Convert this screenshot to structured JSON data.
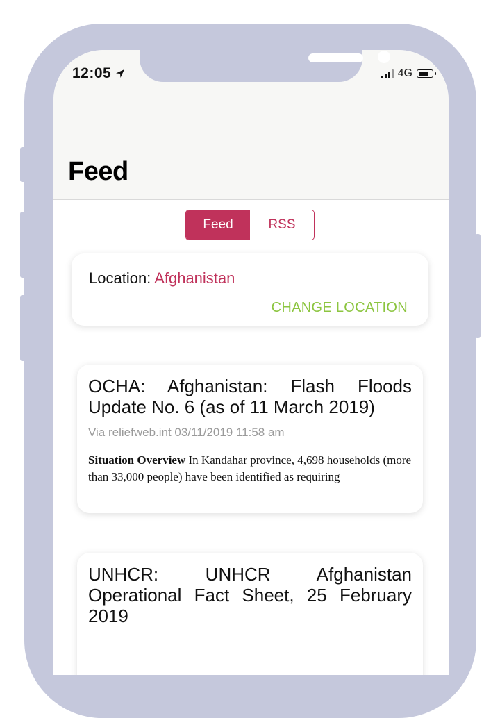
{
  "status_bar": {
    "time": "12:05",
    "network": "4G"
  },
  "header": {
    "title": "Feed"
  },
  "segmented_control": {
    "options": [
      "Feed",
      "RSS"
    ],
    "selected": "Feed"
  },
  "location_card": {
    "label": "Location: ",
    "value": "Afghanistan",
    "change_label": "CHANGE LOCATION"
  },
  "feed_items": [
    {
      "title": "OCHA: Afghanistan: Flash Floods Update No. 6 (as of 11 March 2019)",
      "meta": "Via reliefweb.int 03/11/2019 11:58 am",
      "excerpt_heading": "Situation Overview",
      "excerpt_text": " In Kandahar province, 4,698 households (more than 33,000 people) have been identified as requiring"
    },
    {
      "title": "UNHCR: UNHCR Afghanistan Operational Fact Sheet, 25 February 2019"
    }
  ],
  "colors": {
    "accent": "#c0325b",
    "action_green": "#8cc540",
    "frame": "#c5c8dc",
    "header_bg": "#f7f7f5"
  }
}
